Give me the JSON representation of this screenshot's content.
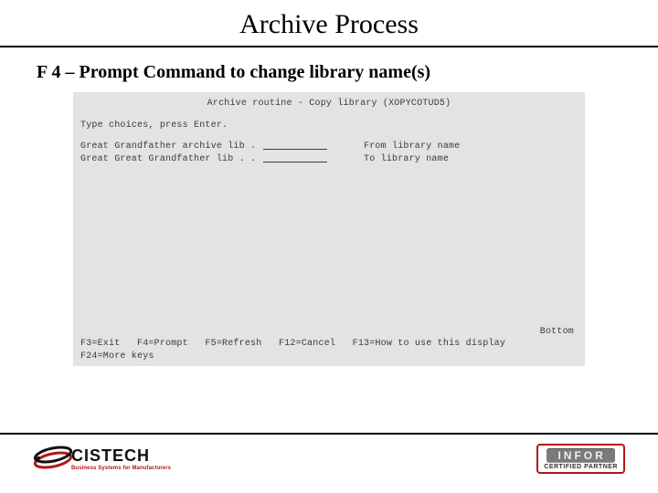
{
  "title": "Archive Process",
  "subtitle": "F 4 – Prompt Command to change library name(s)",
  "terminal": {
    "header": "Archive routine - Copy library (XOPYCOTUD5)",
    "instruction": "Type choices, press Enter.",
    "rows": [
      {
        "label": "Great Grandfather archive lib .",
        "desc": "From library name"
      },
      {
        "label": "Great Great Grandfather lib . .",
        "desc": "To library name"
      }
    ],
    "bottom_label": "Bottom",
    "fnkeys_line1": "F3=Exit   F4=Prompt   F5=Refresh   F12=Cancel   F13=How to use this display",
    "fnkeys_line2": "F24=More keys"
  },
  "logos": {
    "cistech": {
      "name": "CISTECH",
      "tagline": "Business Systems for Manufacturers"
    },
    "infor": {
      "name": "INFOR",
      "tagline": "CERTIFIED PARTNER"
    }
  }
}
